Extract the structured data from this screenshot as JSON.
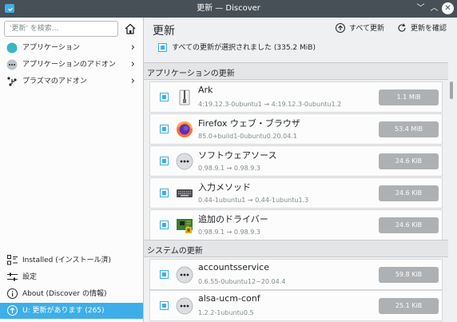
{
  "window": {
    "title": "更新 — Discover"
  },
  "sidebar": {
    "search_placeholder": "'更新' を検索...",
    "items": [
      {
        "label": "アプリケーション"
      },
      {
        "label": "アプリケーションのアドオン"
      },
      {
        "label": "プラズマのアドオン"
      }
    ],
    "bottom": [
      {
        "label": "Installed (インストール済)"
      },
      {
        "label": "設定"
      },
      {
        "label": "About (Discover の情報)"
      },
      {
        "label": "U: 更新があります (265)"
      }
    ]
  },
  "main": {
    "title": "更新",
    "update_all_label": "すべて更新",
    "check_updates_label": "更新を確認",
    "select_all_label": "すべての更新が選択されました (335.2 MiB)",
    "sections": [
      {
        "label": "アプリケーションの更新"
      },
      {
        "label": "システムの更新"
      }
    ],
    "rows": [
      {
        "name": "Ark",
        "version": "4:19.12.3-0ubuntu1 → 4:19.12.3-0ubuntu1.2",
        "size": "1.1 MiB",
        "icon": "ark-icon"
      },
      {
        "name": "Firefox ウェブ・ブラウザ",
        "version": "85.0+build1-0ubuntu0.20.04.1",
        "size": "53.4 MiB",
        "icon": "firefox-icon"
      },
      {
        "name": "ソフトウェアソース",
        "version": "0.98.9.1 → 0.98.9.3",
        "size": "24.6 KiB",
        "icon": "package-icon"
      },
      {
        "name": "入力メソッド",
        "version": "0.44-1ubuntu1 → 0.44-1ubuntu1.3",
        "size": "24.6 KiB",
        "icon": "keyboard-icon"
      },
      {
        "name": "追加のドライバー",
        "version": "0.98.9.1 → 0.98.9.3",
        "size": "24.6 KiB",
        "icon": "driver-icon"
      },
      {
        "name": "accountsservice",
        "version": "0.6.55-0ubuntu12~20.04.4",
        "size": "59.8 KiB",
        "icon": "package-icon"
      },
      {
        "name": "alsa-ucm-conf",
        "version": "1.2.2-1ubuntu0.5",
        "size": "25.1 KiB",
        "icon": "package-icon"
      }
    ]
  },
  "colors": {
    "accent": "#3daee9",
    "titlebar": "#475057",
    "size_badge": "#aeb1b4"
  }
}
